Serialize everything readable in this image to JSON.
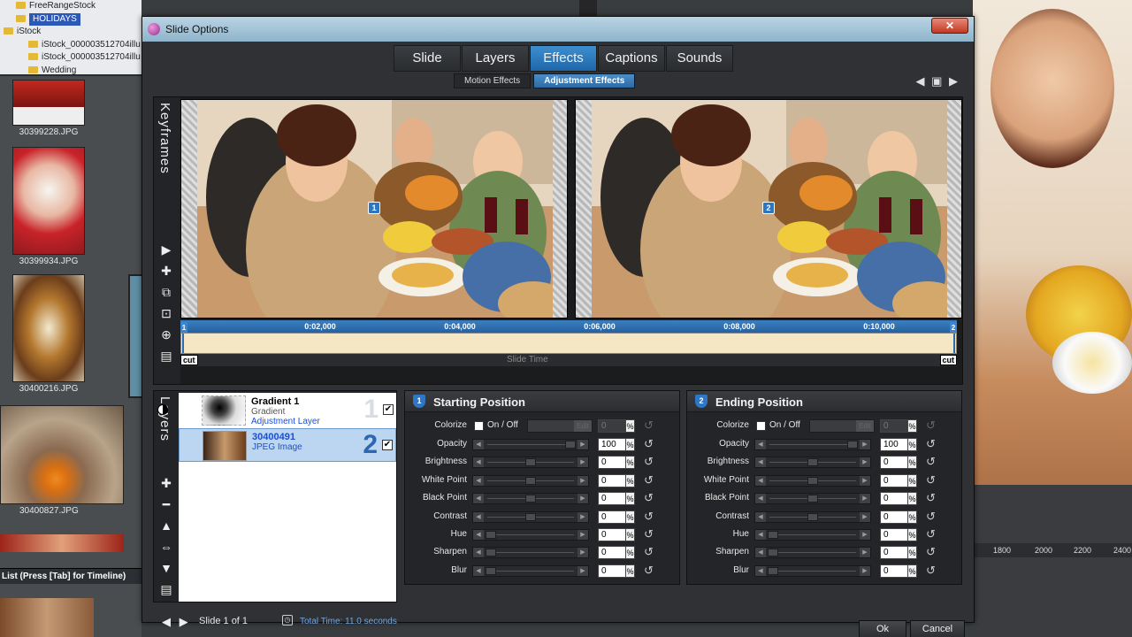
{
  "background": {
    "tree": [
      {
        "label": "FreeRangeStock",
        "indent": 1
      },
      {
        "label": "HOLIDAYS",
        "indent": 1,
        "selected": true
      },
      {
        "label": "iStock",
        "indent": 0
      },
      {
        "label": "iStock_000003512704illu",
        "indent": 2
      },
      {
        "label": "iStock_000003512704illu",
        "indent": 2
      },
      {
        "label": "Wedding",
        "indent": 2
      }
    ],
    "thumbnails": [
      {
        "name": "30399228.JPG"
      },
      {
        "name": "30399934.JPG"
      },
      {
        "name": "30400216.JPG"
      },
      {
        "name": "30400827.JPG"
      }
    ],
    "list_hint": "List (Press [Tab] for Timeline)",
    "ruler_ticks": [
      "1800",
      "2000",
      "2200",
      "2400"
    ]
  },
  "dialog": {
    "title": "Slide Options",
    "close_glyph": "✕",
    "tabs": [
      {
        "label": "Slide",
        "active": false
      },
      {
        "label": "Layers",
        "active": false
      },
      {
        "label": "Effects",
        "active": true
      },
      {
        "label": "Captions",
        "active": false
      },
      {
        "label": "Sounds",
        "active": false
      }
    ],
    "subtabs": [
      {
        "label": "Motion Effects",
        "active": false
      },
      {
        "label": "Adjustment Effects",
        "active": true
      }
    ],
    "nav_glyphs": "◀ ▣ ▶",
    "keyframes_label": "Keyframes",
    "kf_marker_start": "1",
    "kf_marker_end": "2",
    "timeline": {
      "ticks": [
        "0:02,000",
        "0:04,000",
        "0:06,000",
        "0:08,000",
        "0:10,000"
      ],
      "cut_label": "cut",
      "slide_time_label": "Slide Time"
    },
    "layers_label": "Layers",
    "layers": [
      {
        "name": "Gradient 1",
        "type": "Gradient",
        "sub": "Adjustment Layer",
        "number": "1",
        "selected": false
      },
      {
        "name": "30400491",
        "type": "JPEG Image",
        "sub": "",
        "number": "2",
        "selected": true
      }
    ],
    "starting": {
      "title": "Starting Position",
      "badge": "1",
      "colorize_label": "Colorize",
      "onoff_label": "On / Off",
      "edit_label": "Edit",
      "colorize_value": "0",
      "rows": [
        {
          "label": "Opacity",
          "value": "100",
          "pos": 1.0
        },
        {
          "label": "Brightness",
          "value": "0",
          "pos": 0.5
        },
        {
          "label": "White Point",
          "value": "0",
          "pos": 0.5
        },
        {
          "label": "Black Point",
          "value": "0",
          "pos": 0.5
        },
        {
          "label": "Contrast",
          "value": "0",
          "pos": 0.5
        },
        {
          "label": "Hue",
          "value": "0",
          "pos": 0.0
        },
        {
          "label": "Sharpen",
          "value": "0",
          "pos": 0.0
        },
        {
          "label": "Blur",
          "value": "0",
          "pos": 0.0
        }
      ]
    },
    "ending": {
      "title": "Ending Position",
      "badge": "2",
      "colorize_label": "Colorize",
      "onoff_label": "On / Off",
      "edit_label": "Edit",
      "colorize_value": "0",
      "rows": [
        {
          "label": "Opacity",
          "value": "100",
          "pos": 1.0
        },
        {
          "label": "Brightness",
          "value": "0",
          "pos": 0.5
        },
        {
          "label": "White Point",
          "value": "0",
          "pos": 0.5
        },
        {
          "label": "Black Point",
          "value": "0",
          "pos": 0.5
        },
        {
          "label": "Contrast",
          "value": "0",
          "pos": 0.5
        },
        {
          "label": "Hue",
          "value": "0",
          "pos": 0.0
        },
        {
          "label": "Sharpen",
          "value": "0",
          "pos": 0.0
        },
        {
          "label": "Blur",
          "value": "0",
          "pos": 0.0
        }
      ]
    },
    "percent": "%",
    "footer": {
      "slide_count": "Slide 1 of 1",
      "total_time": "Total Time: 11.0 seconds",
      "ok_label": "Ok",
      "cancel_label": "Cancel"
    }
  },
  "colors": {
    "accent": "#2d6aa4",
    "titlebar": "#9fc0d4",
    "timeline_track": "#f5e7c4"
  }
}
